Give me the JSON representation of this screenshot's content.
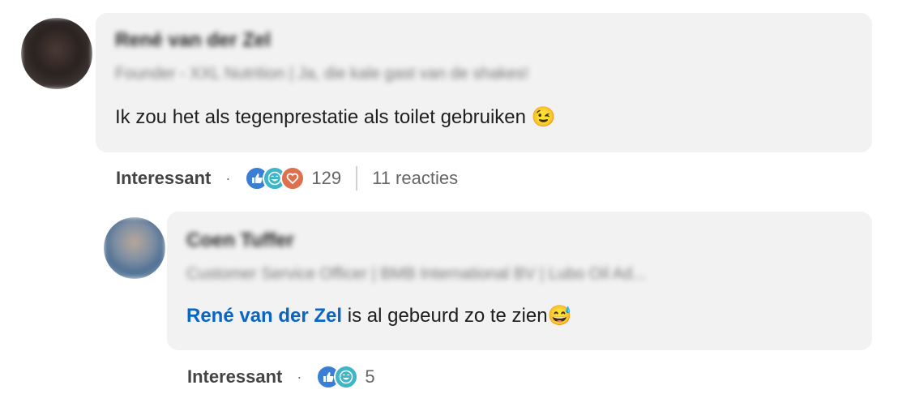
{
  "comment": {
    "author_name": "René van der Zel",
    "author_headline": "Founder - XXL Nutrition | Ja, die kale gast van de shakes!",
    "text": "Ik zou het als tegenprestatie als toilet gebruiken",
    "emoji": "😉",
    "action_label": "Interessant",
    "separator": "·",
    "reaction_icons": [
      "like-icon",
      "funny-icon",
      "love-icon"
    ],
    "reaction_count": "129",
    "replies_label": "11 reacties"
  },
  "reply": {
    "author_name": "Coen Tuffer",
    "author_headline": "Customer Service Officer | BMB International BV | Lubo Oil Ad...",
    "mention": "René van der Zel",
    "text": " is al gebeurd zo te zien",
    "emoji": "😅",
    "action_label": "Interessant",
    "separator": "·",
    "reaction_icons": [
      "like-icon",
      "funny-icon"
    ],
    "reaction_count": "5"
  },
  "colors": {
    "bubble": "#f2f2f2",
    "mention": "#0a66c2",
    "like": "#3b7fd4",
    "funny": "#3fb5c8",
    "love": "#df704d"
  }
}
